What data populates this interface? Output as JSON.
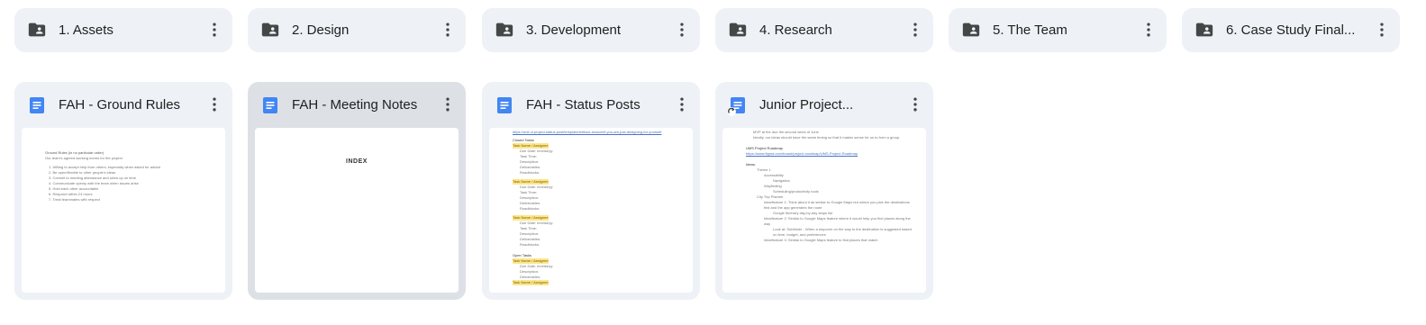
{
  "colors": {
    "tile_bg": "#eef1f6",
    "selected_tile_bg": "#dde1e6",
    "doc_icon_blue": "#4285f4",
    "icon_gray": "#444746"
  },
  "folders": [
    {
      "label": "1. Assets",
      "icon": "shared-folder-icon"
    },
    {
      "label": "2. Design",
      "icon": "shared-folder-icon"
    },
    {
      "label": "3. Development",
      "icon": "shared-folder-icon"
    },
    {
      "label": "4. Research",
      "icon": "shared-folder-icon"
    },
    {
      "label": "5. The Team",
      "icon": "shared-folder-icon"
    },
    {
      "label": "6. Case Study Final...",
      "icon": "shared-folder-icon"
    }
  ],
  "files": [
    {
      "label": "FAH - Ground Rules",
      "icon": "google-docs-icon",
      "preview": {
        "title": "Ground Rules (in no particular order)",
        "intro": "Our team’s agreed working norms for the project",
        "items": [
          "1. Willing to accept help from others, especially when asked for advice",
          "2. Be open/flexible to other people’s ideas",
          "3. Commit to meeting attendance and show up on time",
          "4. Communicate openly with the team when issues arise",
          "5. Hold each other accountable",
          "6. Respond within 24 hours",
          "7. Treat teammates with respect"
        ]
      }
    },
    {
      "label": "FAH - Meeting Notes",
      "icon": "google-docs-icon",
      "selected": true,
      "preview": {
        "heading": "INDEX"
      }
    },
    {
      "label": "FAH - Status Posts",
      "icon": "google-docs-icon",
      "preview": {
        "link": "https://unit.ui.project.status.post/template/without-reason/if-you-are-just-designing-for-yourself",
        "sections": [
          {
            "title": "Closed Tasks",
            "tag": "Task Name / Assignee",
            "items": [
              "Due Date: mm/dd/yy",
              "Task Time:",
              "Description:",
              "Deliverables:",
              "Roadblocks:"
            ]
          },
          {
            "title": "",
            "tag": "Task Name / Assignee",
            "items": [
              "Due Date: mm/dd/yy",
              "Task Time:",
              "Description:",
              "Deliverables:",
              "Roadblocks:"
            ]
          },
          {
            "title": "",
            "tag": "Task Name / Assignee",
            "items": [
              "Due Date: mm/dd/yy",
              "Task Time:",
              "Description:",
              "Deliverables:",
              "Roadblocks:"
            ]
          },
          {
            "title": "Open Tasks",
            "tag": "Task Name / Assignee",
            "items": [
              "Due Date: mm/dd/yy",
              "Description:",
              "Deliverables:"
            ]
          },
          {
            "title": "",
            "tag": "Task Name / Assignee",
            "items": []
          }
        ]
      }
    },
    {
      "label": "Junior Project...",
      "icon": "google-docs-shortcut-icon",
      "preview": {
        "top_bullets": [
          "MVP at the due the second week of June",
          "Ideally, our ideas should have the same timing so that it makes sense for us to form a group"
        ],
        "roadmap_title": "UMS Project Roadmap",
        "roadmap_link": "https://www.figma.com/board/project-roadmap/UMS-Project-Roadmap",
        "ideas_title": "Ideas:",
        "ideas": [
          "Theme 1",
          "Accessibility",
          "Navigation",
          "Wayfinding",
          "Scheduling/productivity tools",
          "City Trip Planner",
          "Idea/feature 1: Think about it as similar to Google Maps but where you pick the destinations first and the app generates the route",
          "Google Itinerary day-by-day stops list",
          "Idea/feature 2: Similar to Google Maps feature where it would help you find places along the way",
          "Look at: SubMode - When a stopover on the way to the destination is suggested based on time, budget, and preferences",
          "Idea/feature 3: Similar to Google Maps feature to find places that match"
        ]
      }
    }
  ]
}
